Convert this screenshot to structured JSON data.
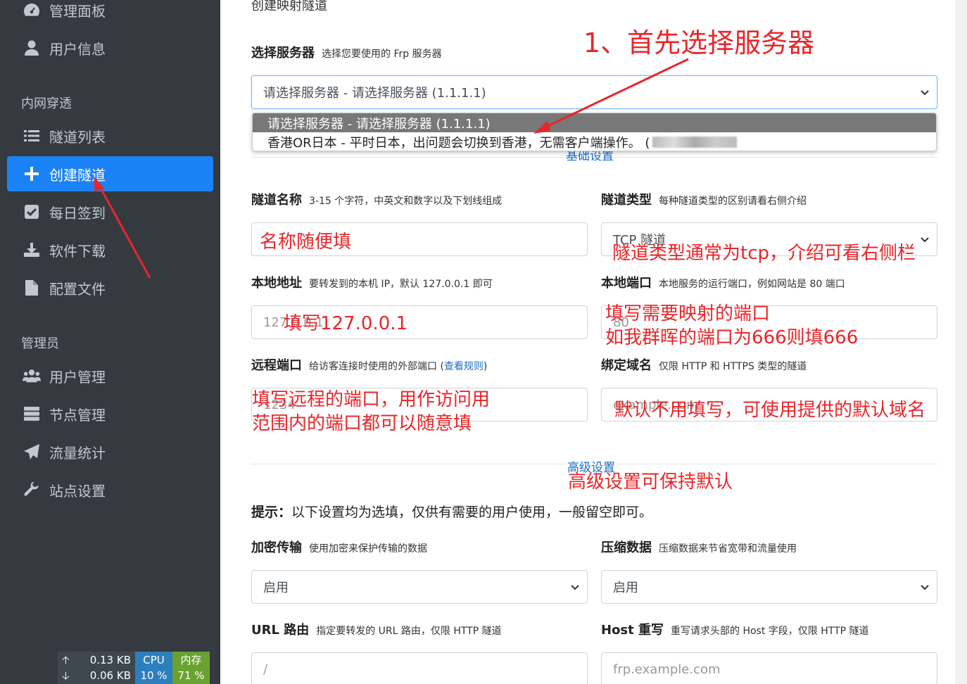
{
  "sidebar": {
    "items": [
      {
        "label": "管理面板",
        "icon": "dashboard-icon"
      },
      {
        "label": "用户信息",
        "icon": "user-icon"
      },
      {
        "label": "隧道列表",
        "icon": "list-icon"
      },
      {
        "label": "创建隧道",
        "icon": "plus-icon"
      },
      {
        "label": "每日签到",
        "icon": "check-square-icon"
      },
      {
        "label": "软件下载",
        "icon": "download-icon"
      },
      {
        "label": "配置文件",
        "icon": "file-icon"
      },
      {
        "label": "用户管理",
        "icon": "users-icon"
      },
      {
        "label": "节点管理",
        "icon": "server-icon"
      },
      {
        "label": "流量统计",
        "icon": "paper-plane-icon"
      },
      {
        "label": "站点设置",
        "icon": "wrench-icon"
      }
    ],
    "headers": {
      "intranet": "内网穿透",
      "admin": "管理员"
    },
    "stats": {
      "up": "0.13 KB",
      "down": "0.06 KB",
      "cpu_label": "CPU",
      "cpu_value": "10 %",
      "mem_label": "内存",
      "mem_value": "71 %"
    }
  },
  "form": {
    "title": "创建映射隧道",
    "server": {
      "label": "选择服务器",
      "help": "选择您要使用的 Frp 服务器",
      "value": "请选择服务器 - 请选择服务器 (1.1.1.1)"
    },
    "dropdown": {
      "options": [
        "请选择服务器 - 请选择服务器 (1.1.1.1)",
        "香港OR日本 - 平时日本，出问题会切换到香港，无需客户端操作。 ("
      ]
    },
    "basic_section": "基础设置",
    "name": {
      "label": "隧道名称",
      "help": "3-15 个字符，中英文和数字以及下划线组成",
      "value": ""
    },
    "type": {
      "label": "隧道类型",
      "help": "每种隧道类型的区别请看右侧介绍",
      "value": "TCP 隧道"
    },
    "local_ip": {
      "label": "本地地址",
      "help": "要转发到的本机 IP，默认 127.0.0.1 即可",
      "placeholder": "127.0.0.1"
    },
    "local_port": {
      "label": "本地端口",
      "help": "本地服务的运行端口，例如网站是 80 端口",
      "placeholder": "80"
    },
    "remote_port": {
      "label": "远程端口",
      "help": "给访客连接时使用的外部端口 (",
      "link": "查看规则",
      "help_end": ")",
      "placeholder": "1234"
    },
    "domain": {
      "label": "绑定域名",
      "help": "仅限 HTTP 和 HTTPS 类型的隧道",
      "placeholder": "example.com"
    },
    "advanced_section": "高级设置",
    "tip_label": "提示：",
    "tip_text": "以下设置均为选填，仅供有需要的用户使用，一般留空即可。",
    "encrypt": {
      "label": "加密传输",
      "help": "使用加密来保护传输的数据",
      "value": "启用"
    },
    "compress": {
      "label": "压缩数据",
      "help": "压缩数据来节省宽带和流量使用",
      "value": "启用"
    },
    "url_route": {
      "label": "URL 路由",
      "help": "指定要转发的 URL 路由，仅限 HTTP 隧道",
      "placeholder": "/"
    },
    "host_rewrite": {
      "label": "Host 重写",
      "help": "重写请求头部的 Host 字段，仅限 HTTP 隧道",
      "placeholder": "frp.example.com"
    }
  },
  "annotations": {
    "step1": "1、首先选择服务器",
    "name": "名称随便填",
    "type": "隧道类型通常为tcp，介绍可看右侧栏",
    "local_ip": "填写127.0.0.1",
    "local_port_1": "填写需要映射的端口",
    "local_port_2": "如我群晖的端口为666则填666",
    "remote_1": "填写远程的端口，用作访问用",
    "remote_2": "范围内的端口都可以随意填",
    "domain": "默认不用填写，可使用提供的默认域名",
    "advanced": "高级设置可保持默认"
  },
  "colors": {
    "sidebar_bg": "#343a40",
    "active": "#1b82f5",
    "annotation": "#e8262a"
  }
}
